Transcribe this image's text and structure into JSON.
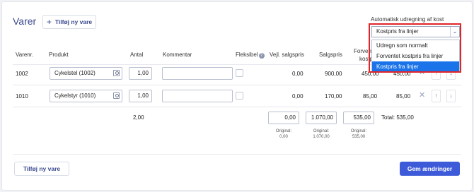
{
  "header": {
    "title": "Varer",
    "add_button_label": "Tilføj ny vare"
  },
  "auto_cost": {
    "label": "Automatisk udregning af kost",
    "selected": "Kostpris fra linjer",
    "options": [
      "Udregn som normalt",
      "Forventet kostpris fra linjer",
      "Kostpris fra linjer"
    ]
  },
  "table": {
    "columns": {
      "varenr": "Varenr.",
      "produkt": "Produkt",
      "antal": "Antal",
      "kommentar": "Kommentar",
      "fleksibel": "Fleksibel",
      "vejl_salgspris": "Vejl. salgspris",
      "salgspris": "Salgspris",
      "forventet_kostpris_line1": "Forven",
      "forventet_kostpris_line2": "kostp"
    },
    "rows": [
      {
        "varenr": "1002",
        "produkt": "Cykelstel (1002)",
        "antal": "1,00",
        "kommentar": "",
        "vejl_salgspris": "0,00",
        "salgspris": "900,00",
        "kostpris": "450,00",
        "kostpris2": "450,00"
      },
      {
        "varenr": "1010",
        "produkt": "Cykelstyr (1010)",
        "antal": "1,00",
        "kommentar": "",
        "vejl_salgspris": "0,00",
        "salgspris": "170,00",
        "kostpris": "85,00",
        "kostpris2": "85,00"
      }
    ]
  },
  "totals": {
    "antal": "2,00",
    "vejl_salgspris": "0,00",
    "salgspris": "1.070,00",
    "kostpris": "535,00",
    "total_label": "Total: 535,00",
    "original_label": "Original:",
    "original_vejl": "0,00",
    "original_salgspris": "1.070,00",
    "original_kostpris": "535,00"
  },
  "footer": {
    "add_button_label": "Tilføj ny vare",
    "save_button_label": "Gem ændringer"
  },
  "colors": {
    "accent": "#3d5bd8",
    "highlight_border": "#e0242a",
    "selected_option": "#1a73e8"
  }
}
